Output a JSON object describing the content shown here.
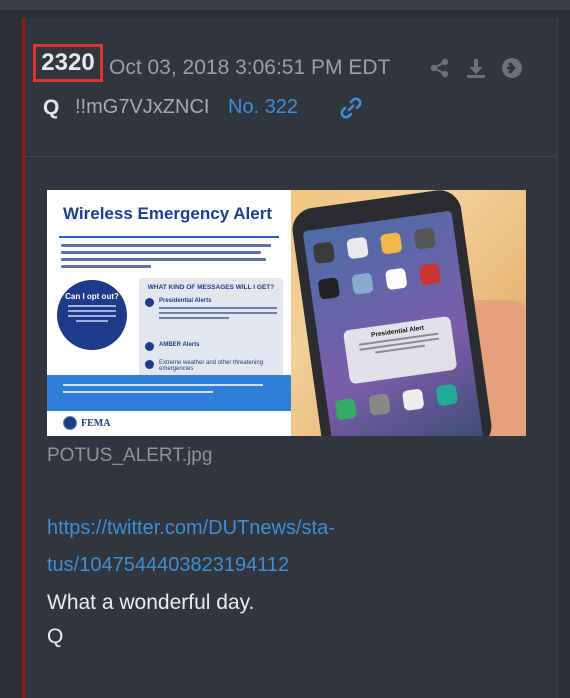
{
  "post": {
    "number": "2320",
    "date": "Oct 03, 2018 3:06:51 PM EDT",
    "author": "Q",
    "tripcode": "!!mG7VJxZNCI",
    "post_no": "No. 322"
  },
  "icons": [
    "share-icon",
    "download-icon",
    "arrow-right-circle-icon",
    "link-icon"
  ],
  "image": {
    "alt_title": "Wireless Emergency Alert",
    "opt_out": "Can I opt out?",
    "messages_heading": "WHAT KIND OF MESSAGES WILL I GET?",
    "presidential": "Presidential Alerts",
    "amber": "AMBER Alerts",
    "extreme": "Extreme weather and other threatening emergencies",
    "fema": "FEMA",
    "phone_alert_title": "Presidential Alert",
    "filename": "POTUS_ALERT.jpg"
  },
  "body": {
    "url": "https://twitter.com/DUTnews/status/1047544403823194112",
    "url_line1": "https://twitter.com/DUTnews/sta-",
    "url_line2": "tus/1047544403823194112",
    "message": "What a wonderful day.",
    "signature": "Q"
  },
  "colors": {
    "background": "#2b2f36",
    "card": "#31353d",
    "accent_border": "#8e1b1b",
    "highlight_box": "#d93535",
    "link": "#3d8fd6"
  }
}
